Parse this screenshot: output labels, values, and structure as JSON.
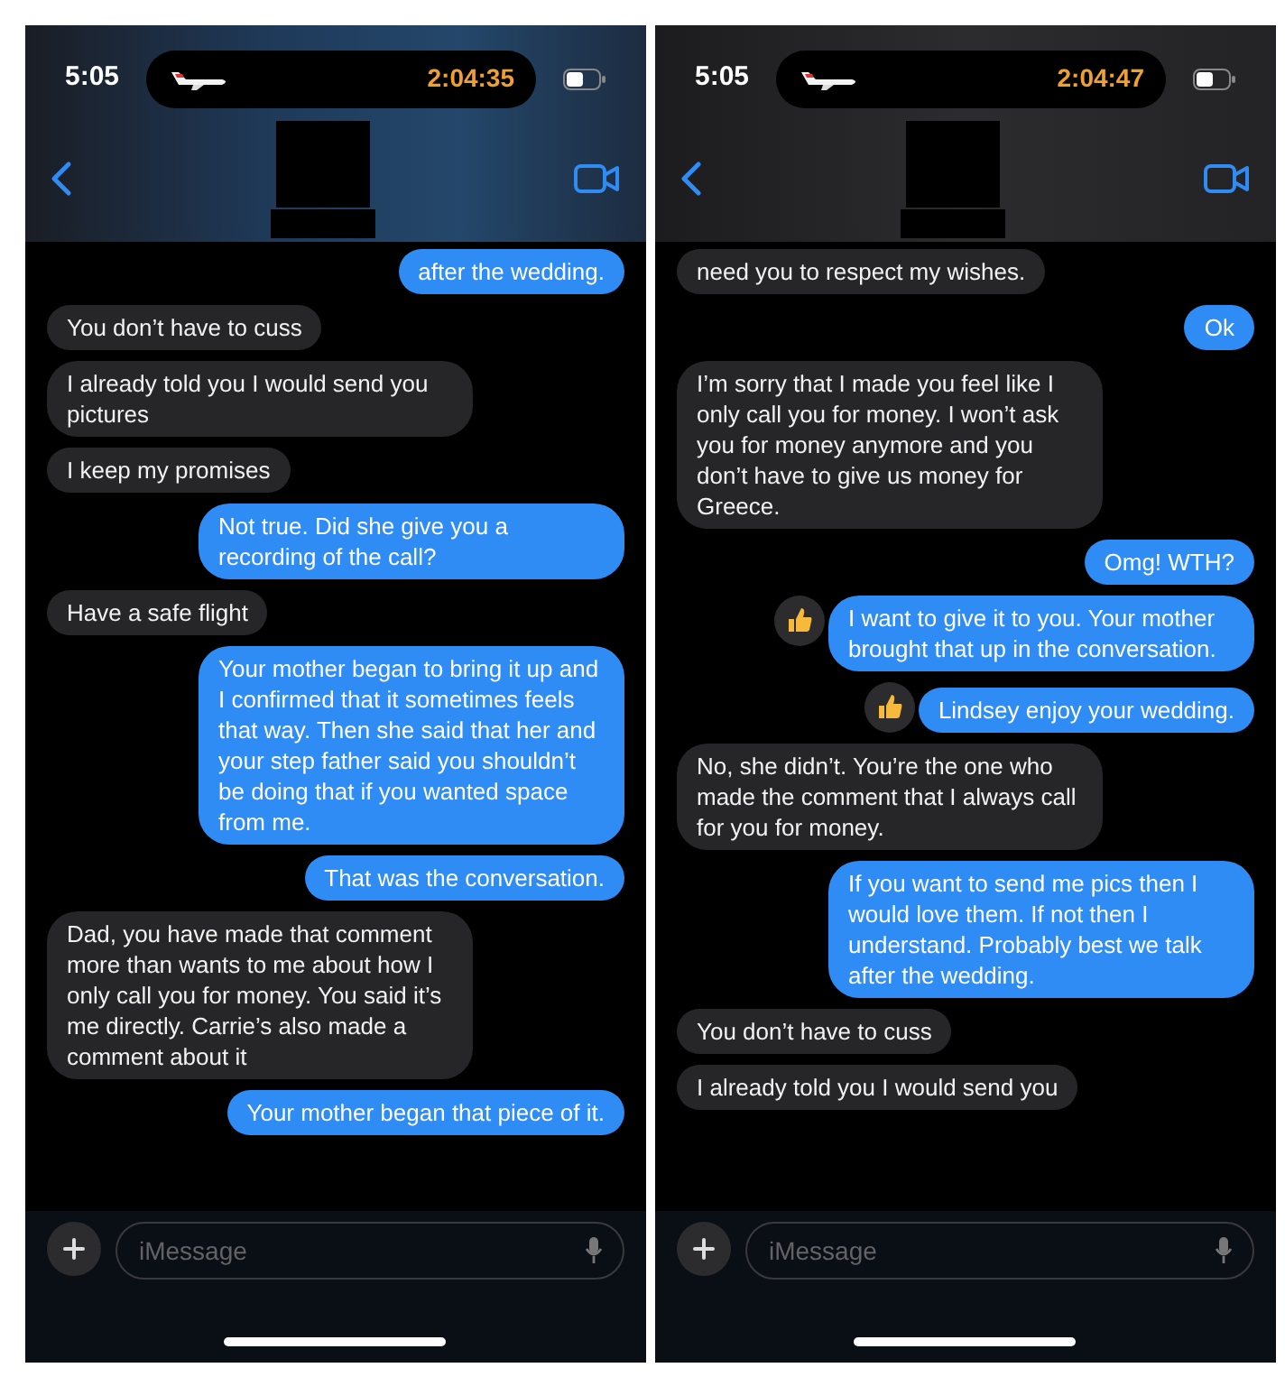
{
  "phones": [
    {
      "status_bar": {
        "time": "5:05",
        "activity_timer": "2:04:35"
      },
      "messages": [
        {
          "kind": "sent",
          "text": "after the wedding.",
          "liked": false
        },
        {
          "kind": "received",
          "text": "You don’t have to cuss",
          "liked": false
        },
        {
          "kind": "received",
          "text": "I already told you I would send you pictures",
          "liked": false
        },
        {
          "kind": "received",
          "text": "I keep my promises",
          "liked": false
        },
        {
          "kind": "sent",
          "text": "Not true. Did she give you a recording of the call?",
          "liked": false
        },
        {
          "kind": "received",
          "text": "Have a safe flight",
          "liked": false
        },
        {
          "kind": "sent",
          "text": "Your mother began to bring it up and I confirmed that it sometimes feels that way. Then she said that her and your step father said you shouldn’t be doing that if you wanted space from me.",
          "liked": false
        },
        {
          "kind": "sent",
          "text": "That was the conversation.",
          "liked": false
        },
        {
          "kind": "received",
          "text": "Dad, you have made that comment more than wants to me about how I only call you for money. You said it’s me directly. Carrie’s also made a comment about it",
          "liked": false
        },
        {
          "kind": "sent",
          "text": "Your mother began that piece of it.",
          "liked": false
        }
      ],
      "compose": {
        "placeholder": "iMessage"
      }
    },
    {
      "status_bar": {
        "time": "5:05",
        "activity_timer": "2:04:47"
      },
      "messages": [
        {
          "kind": "received",
          "text": "need you to respect my wishes.",
          "liked": false
        },
        {
          "kind": "sent",
          "text": "Ok",
          "liked": false
        },
        {
          "kind": "received",
          "text": "I’m sorry that I made you feel like I only call you for money. I won’t ask you for money anymore and you don’t have to give us money for Greece.",
          "liked": false
        },
        {
          "kind": "sent",
          "text": "Omg! WTH?",
          "liked": false
        },
        {
          "kind": "sent",
          "text": "I want to give it to you. Your mother brought that up in the conversation.",
          "liked": true
        },
        {
          "kind": "sent",
          "text": "Lindsey enjoy your wedding.",
          "liked": true
        },
        {
          "kind": "received",
          "text": "No, she didn’t. You’re the one who made the comment that I always call for you for money.",
          "liked": false
        },
        {
          "kind": "sent",
          "text": "If you want to send me pics then I would love them. If not then I understand. Probably best we talk after the wedding.",
          "liked": false
        },
        {
          "kind": "received",
          "text": "You don’t have to cuss",
          "liked": false
        },
        {
          "kind": "received",
          "text": "I already told you I would send you",
          "liked": false
        }
      ],
      "compose": {
        "placeholder": "iMessage"
      }
    }
  ]
}
